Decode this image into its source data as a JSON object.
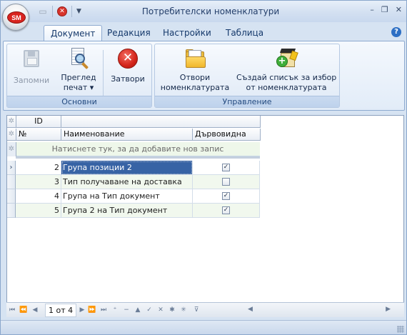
{
  "app": {
    "orb_logo": "SM",
    "title": "Потребителски номенклатури"
  },
  "quick_access": {
    "icons": [
      "save-icon",
      "close-icon",
      "customize-arrow-icon"
    ]
  },
  "window_controls": {
    "minimize": "–",
    "restore": "❐",
    "close": "✕"
  },
  "tabs": [
    {
      "label": "Документ",
      "active": true
    },
    {
      "label": "Редакция",
      "active": false
    },
    {
      "label": "Настройки",
      "active": false
    },
    {
      "label": "Таблица",
      "active": false
    }
  ],
  "ribbon": {
    "groups": [
      {
        "label": "Основни",
        "buttons": [
          {
            "label": "Запомни",
            "icon": "floppy-disk-icon",
            "enabled": false
          },
          {
            "label": "Преглед",
            "label2": "печат ▾",
            "icon": "print-preview-icon",
            "enabled": true
          },
          {
            "label": "Затвори",
            "icon": "close-circle-icon",
            "enabled": true
          }
        ]
      },
      {
        "label": "Управление",
        "buttons": [
          {
            "label": "Отвори",
            "label2": "номенклатурата",
            "icon": "open-folder-icon",
            "enabled": true
          },
          {
            "label": "Създай списък за избор",
            "label2": "от номенклатурата",
            "icon": "create-list-icon",
            "enabled": true
          }
        ]
      }
    ]
  },
  "grid": {
    "band_header": "ID",
    "columns": [
      "№",
      "Наименование",
      "Дървовидна"
    ],
    "new_row_prompt": "Натиснете тук, за да добавите нов запис",
    "rows": [
      {
        "no": "2",
        "name": "Група позиции 2",
        "tree": true,
        "selected": true
      },
      {
        "no": "3",
        "name": "Тип получаване на доставка",
        "tree": false,
        "selected": false
      },
      {
        "no": "4",
        "name": "Група на Тип документ",
        "tree": true,
        "selected": false
      },
      {
        "no": "5",
        "name": "Група 2 на Тип документ",
        "tree": true,
        "selected": false
      }
    ]
  },
  "navigator": {
    "position": "1 от 4"
  },
  "colors": {
    "selection": "#3763a5",
    "ribbon_text": "#15396b",
    "new_row_bg": "#eef7ea"
  }
}
